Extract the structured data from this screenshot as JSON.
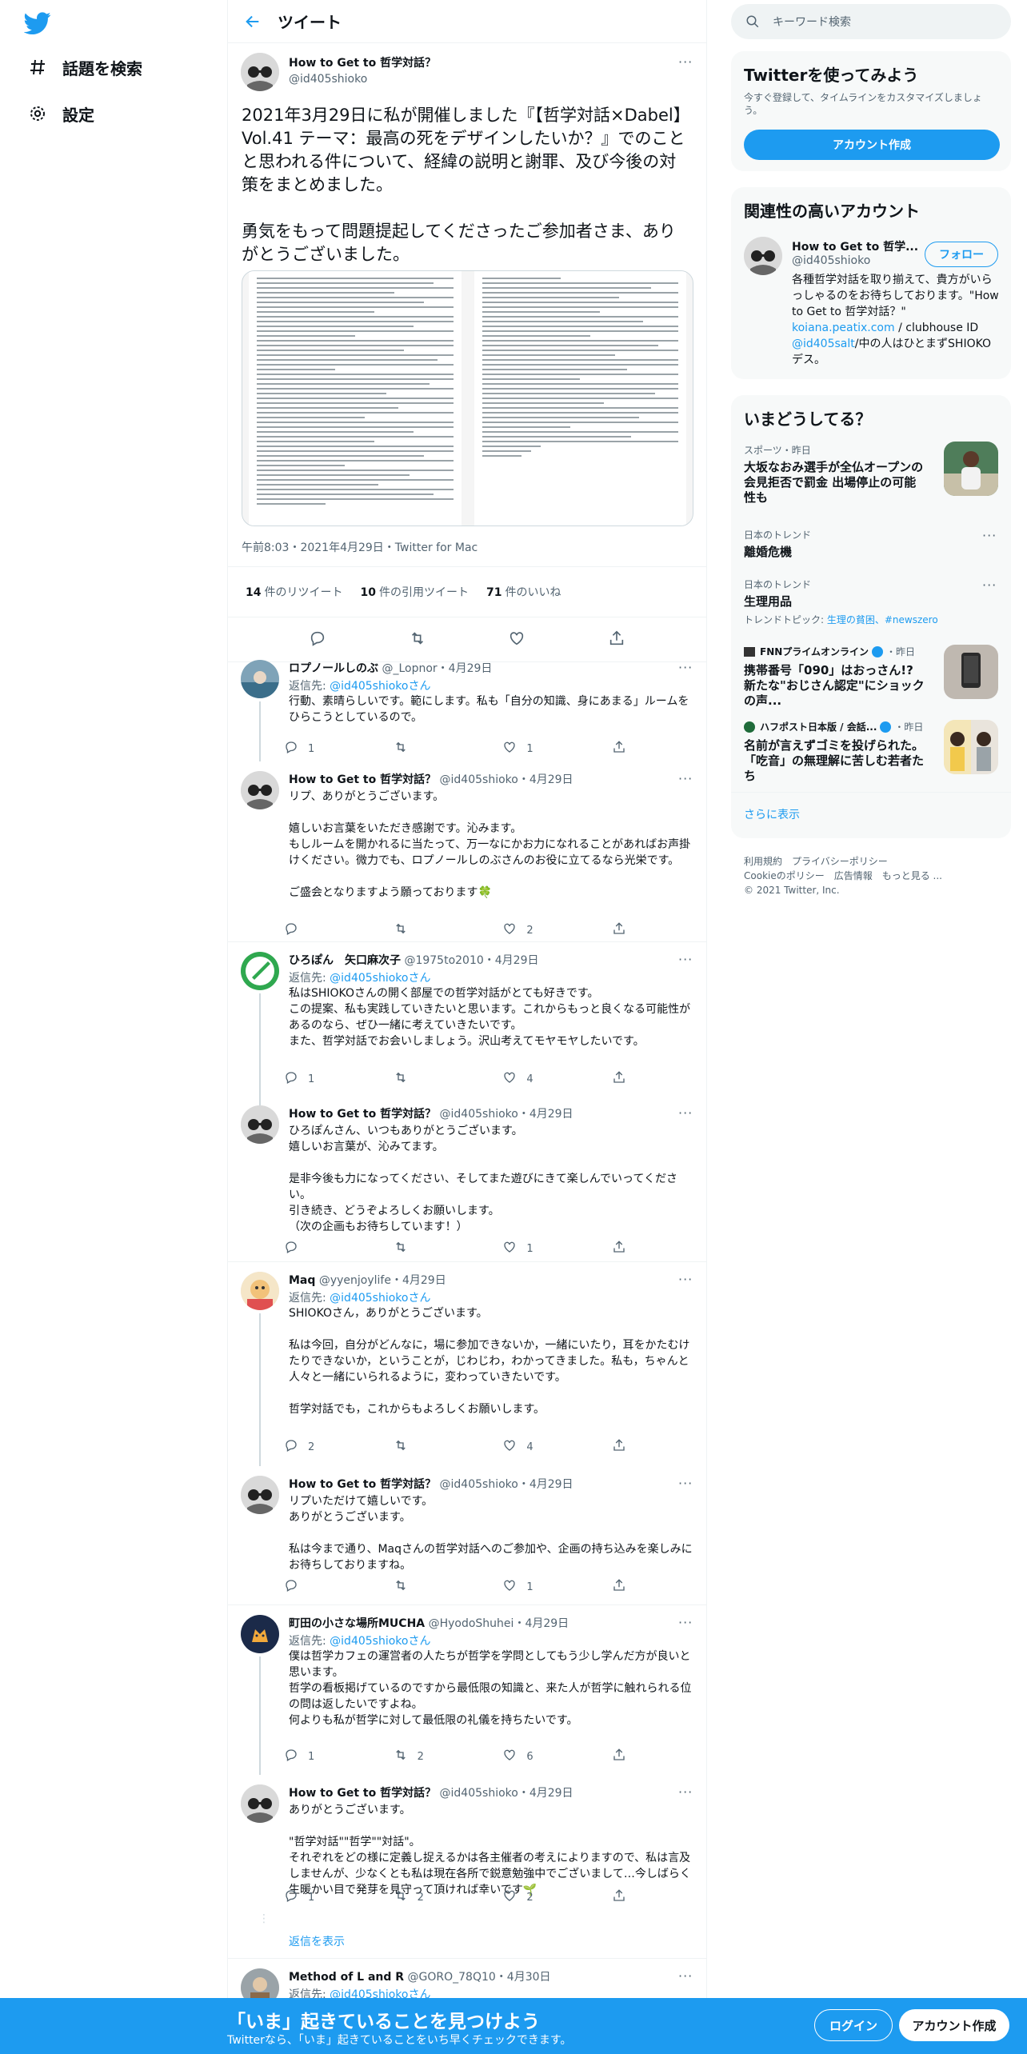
{
  "nav": {
    "explore": "話題を検索",
    "settings": "設定"
  },
  "header": {
    "title": "ツイート"
  },
  "focal": {
    "name": "How to Get to 哲学対話？",
    "handle": "@id405shioko",
    "text": "2021年3月29日に私が開催しました『【哲学対話×Dabel】Vol.41 テーマ：最高の死をデザインしたいか？』でのことと思われる件について、経緯の説明と謝罪、及び今後の対策をまとめました。\n\n勇気をもって問題提起してくださったご参加者さま、ありがとうございました。",
    "timestamp": "午前8:03・2021年4月29日・Twitter for Mac",
    "retweets_count": "14",
    "retweets_label": "件のリツイート",
    "quotes_count": "10",
    "quotes_label": "件の引用ツイート",
    "likes_count": "71",
    "likes_label": "件のいいね"
  },
  "replies": [
    {
      "name": "ロプノールしのぶ",
      "handle": "@_Lopnor",
      "date": "4月29日",
      "reply_to": "@id405shiokoさん",
      "text": "行動、素晴らしいです。範にします。私も「自分の知識、身にあまる」ルームをひらこうとしているので。",
      "reply_count": "1",
      "retweet_count": "",
      "like_count": "1"
    },
    {
      "name": "How to Get to 哲学対話？",
      "handle": "@id405shioko",
      "date": "4月29日",
      "text": "リプ、ありがとうございます。\n\n嬉しいお言葉をいただき感謝です。沁みます。\nもしルームを開かれるに当たって、万一なにかお力になれることがあればお声掛けください。微力でも、ロプノールしのぶさんのお役に立てるなら光栄です。\n\nご盛会となりますよう願っております🍀",
      "reply_count": "",
      "retweet_count": "",
      "like_count": "2"
    },
    {
      "name": "ひろぽん　矢口麻次子",
      "handle": "@1975to2010",
      "date": "4月29日",
      "reply_to": "@id405shiokoさん",
      "text": "私はSHIOKOさんの開く部屋での哲学対話がとても好きです。\nこの提案、私も実践していきたいと思います。これからもっと良くなる可能性があるのなら、ぜひ一緒に考えていきたいです。\nまた、哲学対話でお会いしましょう。沢山考えてモヤモヤしたいです。",
      "reply_count": "1",
      "retweet_count": "",
      "like_count": "4"
    },
    {
      "name": "How to Get to 哲学対話？",
      "handle": "@id405shioko",
      "date": "4月29日",
      "text": "ひろぽんさん、いつもありがとうございます。\n嬉しいお言葉が、沁みてます。\n\n是非今後も力になってください、そしてまた遊びにきて楽しんでいってください。\n引き続き、どうぞよろしくお願いします。\n（次の企画もお待ちしています！）",
      "reply_count": "",
      "retweet_count": "",
      "like_count": "1"
    },
    {
      "name": "Maq",
      "handle": "@yyenjoylife",
      "date": "4月29日",
      "reply_to": "@id405shiokoさん",
      "text": "SHIOKOさん，ありがとうございます。\n\n私は今回，自分がどんなに，場に参加できないか，一緒にいたり，耳をかたむけたりできないか，ということが，じわじわ，わかってきました。私も，ちゃんと人々と一緒にいられるように，変わっていきたいです。\n\n哲学対話でも，これからもよろしくお願いします。",
      "reply_count": "2",
      "retweet_count": "",
      "like_count": "4"
    },
    {
      "name": "How to Get to 哲学対話？",
      "handle": "@id405shioko",
      "date": "4月29日",
      "text": "リプいただけて嬉しいです。\nありがとうございます。\n\n私は今まで通り、Maqさんの哲学対話へのご参加や、企画の持ち込みを楽しみにお待ちしておりますね。",
      "reply_count": "",
      "retweet_count": "",
      "like_count": "1"
    },
    {
      "name": "町田の小さな場所MUCHA",
      "handle": "@HyodoShuhei",
      "date": "4月29日",
      "reply_to": "@id405shiokoさん",
      "text": "僕は哲学カフェの運営者の人たちが哲学を学問としてもう少し学んだ方が良いと思います。\n哲学の看板掲げているのですから最低限の知識と、来た人が哲学に触れられる位の問は返したいですよね。\n何よりも私が哲学に対して最低限の礼儀を持ちたいです。",
      "reply_count": "1",
      "retweet_count": "2",
      "like_count": "6"
    },
    {
      "name": "How to Get to 哲学対話？",
      "handle": "@id405shioko",
      "date": "4月29日",
      "text": "ありがとうございます。\n\n\"哲学対話\"\"哲学\"\"対話\"。\nそれぞれをどの様に定義し捉えるかは各主催者の考えによりますので、私は言及しませんが、少なくとも私は現在各所で鋭意勉強中でございまして…今しばらく生暖かい目で発芽を見守って頂ければ幸いです🌱",
      "reply_count": "1",
      "retweet_count": "2",
      "like_count": "2"
    },
    {
      "name": "Method of L and R",
      "handle": "@GORO_78Q10",
      "date": "4月30日",
      "reply_to": "@id405shiokoさん",
      "text": "",
      "reply_count": "",
      "retweet_count": "",
      "like_count": ""
    }
  ],
  "show_replies": "返信を表示",
  "reply_to_prefix": "返信先: ",
  "search": {
    "placeholder": "キーワード検索"
  },
  "signup_card": {
    "title": "Twitterを使ってみよう",
    "subtitle": "今すぐ登録して、タイムラインをカスタマイズしましょう。",
    "button": "アカウント作成"
  },
  "related": {
    "title": "関連性の高いアカウント",
    "name": "How to Get to 哲学...",
    "handle": "@id405shioko",
    "follow": "フォロー",
    "bio_line1": "各種哲学対話を取り揃えて、貴方がいらっしゃるのをお待ちしております。\"How to Get to 哲学対話？\"",
    "bio_link1": "koiana.peatix.com",
    "bio_line2": " / clubhouse ID",
    "bio_link2": "@id405salt",
    "bio_line3": "/中の人はひとまずSHIOKOデス。"
  },
  "whats_happening": {
    "title": "いまどうしてる？",
    "items": [
      {
        "meta": "スポーツ・昨日",
        "title": "大坂なおみ選手が全仏オープンの会見拒否で罰金 出場停止の可能性も"
      },
      {
        "meta": "日本のトレンド",
        "title": "離婚危機"
      },
      {
        "meta": "日本のトレンド",
        "title": "生理用品",
        "extra_label": "トレンドトピック: ",
        "extra_links": "生理の貧困、#newszero"
      },
      {
        "source": "FNNプライムオンライン",
        "time": "・昨日",
        "title": "携帯番号「090」はおっさん!? 新たな\"おじさん認定\"にショックの声..."
      },
      {
        "source": "ハフポスト日本版 / 会話...",
        "time": "・昨日",
        "title": "名前が言えずゴミを投げられた。「吃音」の無理解に苦しむ若者たち"
      }
    ],
    "show_more": "さらに表示"
  },
  "footer": {
    "line1": "利用規約　プライバシーポリシー",
    "line2": "Cookieのポリシー　広告情報　もっと見る ...",
    "line3": "© 2021 Twitter, Inc."
  },
  "bottom_bar": {
    "title": "「いま」起きていることを見つけよう",
    "subtitle": "Twitterなら、「いま」起きていることをいち早くチェックできます。",
    "login": "ログイン",
    "signup": "アカウント作成"
  },
  "colors": {
    "accent": "#1d9bf0",
    "text": "#0f1419",
    "muted": "#536471"
  }
}
